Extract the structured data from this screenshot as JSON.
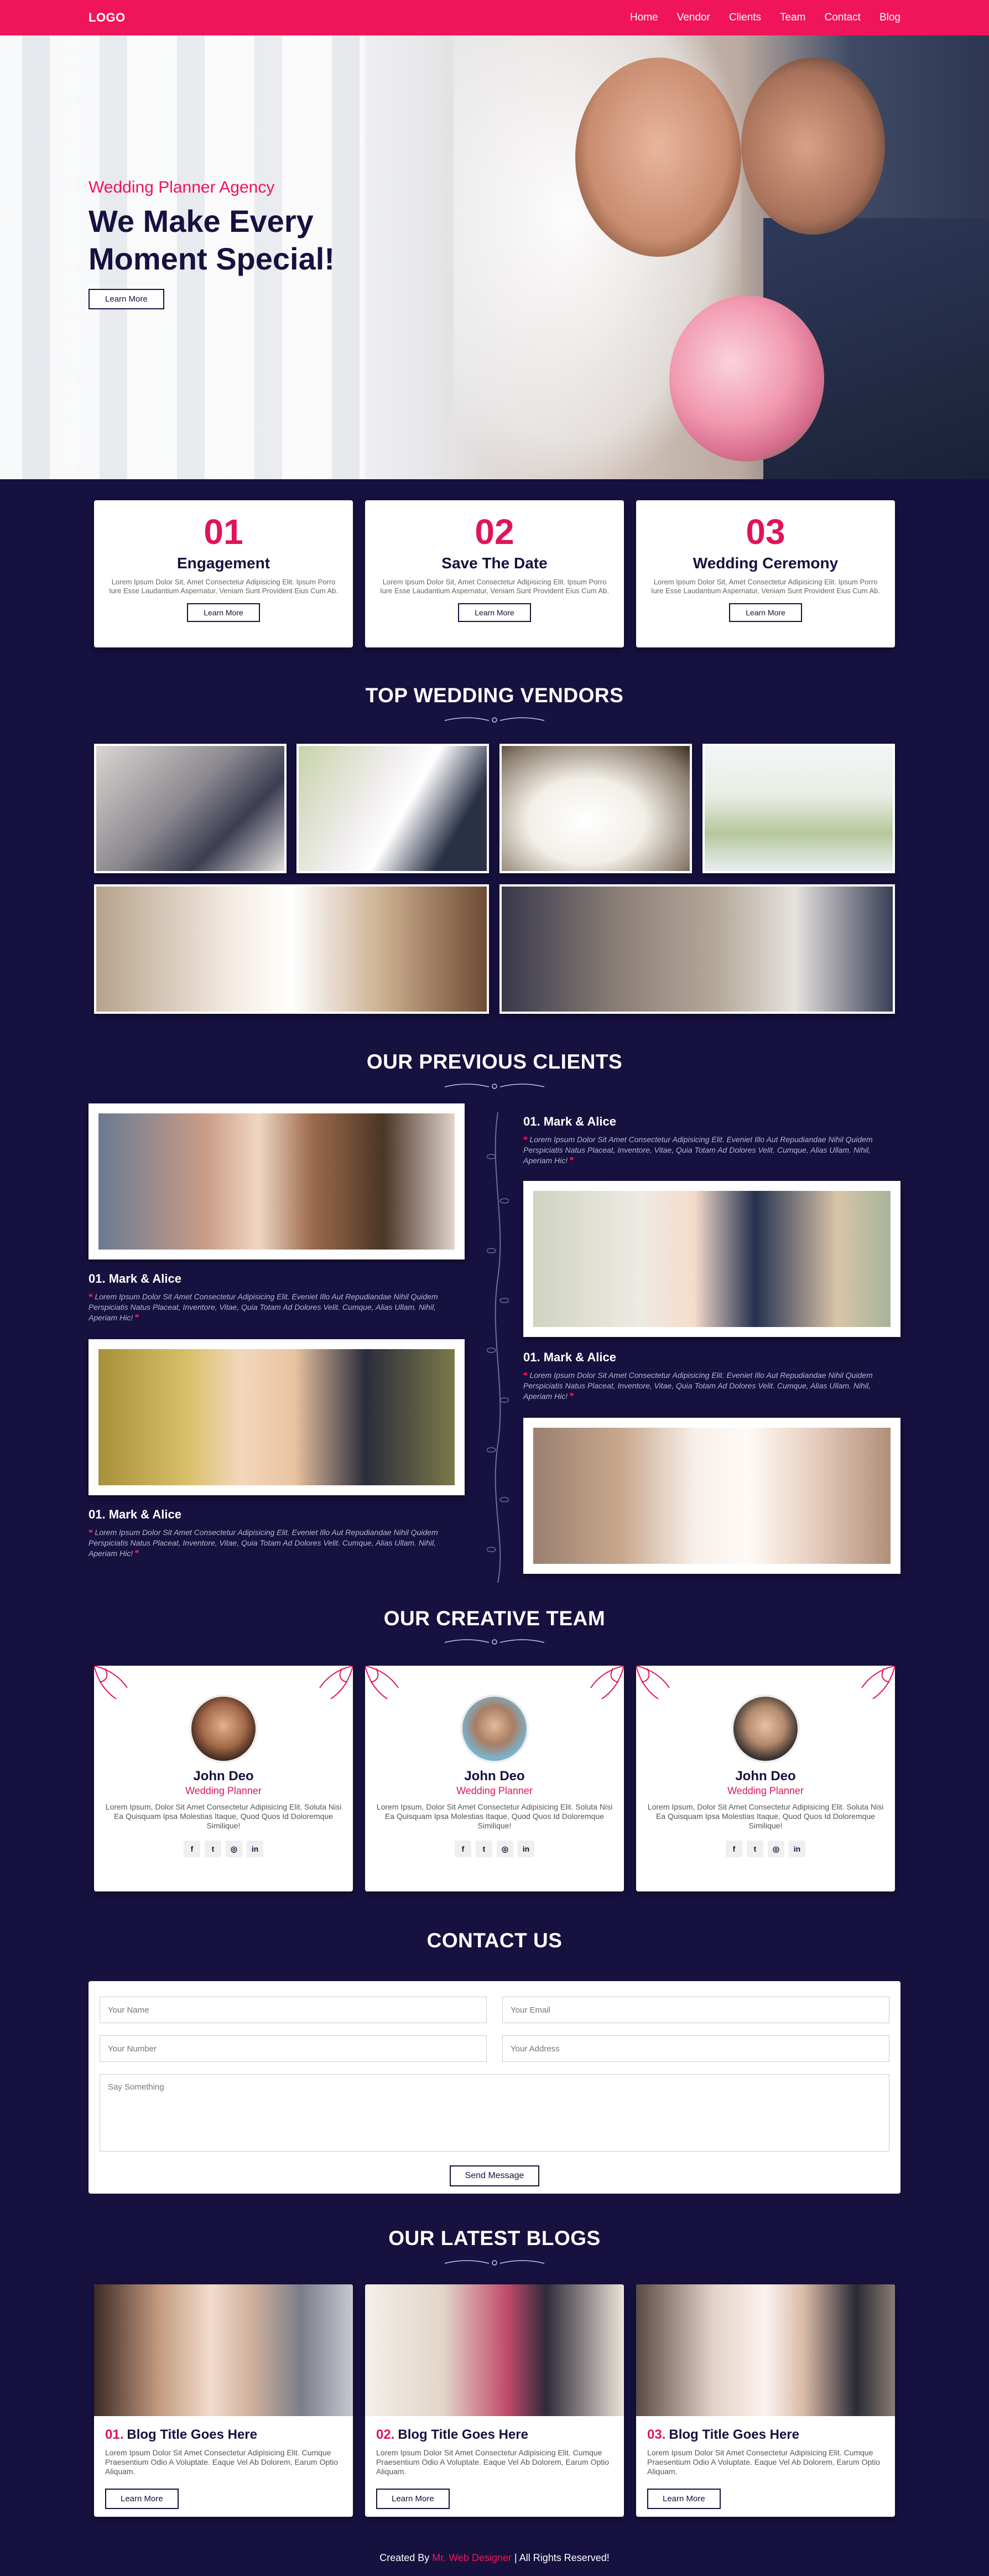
{
  "header": {
    "logo": "LOGO",
    "nav": [
      "Home",
      "Vendor",
      "Clients",
      "Team",
      "Contact",
      "Blog"
    ]
  },
  "hero": {
    "subtitle": "Wedding Planner Agency",
    "title": "We Make Every Moment Special!",
    "button": "Learn More"
  },
  "steps": [
    {
      "num": "01",
      "title": "Engagement",
      "text": "Lorem Ipsum Dolor Sit, Amet Consectetur Adipisicing Elit. Ipsum Porro Iure Esse Laudantium Aspernatur, Veniam Sunt Provident Eius Cum Ab.",
      "button": "Learn More"
    },
    {
      "num": "02",
      "title": "Save The Date",
      "text": "Lorem Ipsum Dolor Sit, Amet Consectetur Adipisicing Elit. Ipsum Porro Iure Esse Laudantium Aspernatur, Veniam Sunt Provident Eius Cum Ab.",
      "button": "Learn More"
    },
    {
      "num": "03",
      "title": "Wedding Ceremony",
      "text": "Lorem Ipsum Dolor Sit, Amet Consectetur Adipisicing Elit. Ipsum Porro Iure Esse Laudantium Aspernatur, Veniam Sunt Provident Eius Cum Ab.",
      "button": "Learn More"
    }
  ],
  "vendors": {
    "title": "TOP WEDDING VENDORS"
  },
  "clients": {
    "title": "OUR PREVIOUS CLIENTS",
    "items": [
      {
        "name": "01. Mark & Alice",
        "text": "Lorem Ipsum Dolor Sit Amet Consectetur Adipisicing Elit. Eveniet Illo Aut Repudiandae Nihil Quidem Perspiciatis Natus Placeat, Inventore, Vitae, Quia Totam Ad Dolores Velit. Cumque, Alias Ullam. Nihil, Aperiam Hic!"
      },
      {
        "name": "01. Mark & Alice",
        "text": "Lorem Ipsum Dolor Sit Amet Consectetur Adipisicing Elit. Eveniet Illo Aut Repudiandae Nihil Quidem Perspiciatis Natus Placeat, Inventore, Vitae, Quia Totam Ad Dolores Velit. Cumque, Alias Ullam. Nihil, Aperiam Hic!"
      },
      {
        "name": "01. Mark & Alice",
        "text": "Lorem Ipsum Dolor Sit Amet Consectetur Adipisicing Elit. Eveniet Illo Aut Repudiandae Nihil Quidem Perspiciatis Natus Placeat, Inventore, Vitae, Quia Totam Ad Dolores Velit. Cumque, Alias Ullam. Nihil, Aperiam Hic!"
      },
      {
        "name": "01. Mark & Alice",
        "text": "Lorem Ipsum Dolor Sit Amet Consectetur Adipisicing Elit. Eveniet Illo Aut Repudiandae Nihil Quidem Perspiciatis Natus Placeat, Inventore, Vitae, Quia Totam Ad Dolores Velit. Cumque, Alias Ullam. Nihil, Aperiam Hic!"
      }
    ]
  },
  "team": {
    "title": "OUR CREATIVE TEAM",
    "members": [
      {
        "name": "John Deo",
        "role": "Wedding Planner",
        "text": "Lorem Ipsum, Dolor Sit Amet Consectetur Adipisicing Elit. Soluta Nisi Ea Quisquam Ipsa Molestias Itaque, Quod Quos Id Doloremque Similique!"
      },
      {
        "name": "John Deo",
        "role": "Wedding Planner",
        "text": "Lorem Ipsum, Dolor Sit Amet Consectetur Adipisicing Elit. Soluta Nisi Ea Quisquam Ipsa Molestias Itaque, Quod Quos Id Doloremque Similique!"
      },
      {
        "name": "John Deo",
        "role": "Wedding Planner",
        "text": "Lorem Ipsum, Dolor Sit Amet Consectetur Adipisicing Elit. Soluta Nisi Ea Quisquam Ipsa Molestias Itaque, Quod Quos Id Doloremque Similique!"
      }
    ],
    "social_icons": [
      "facebook-icon",
      "twitter-icon",
      "instagram-icon",
      "linkedin-icon"
    ]
  },
  "contact": {
    "title": "CONTACT US",
    "name_ph": "Your Name",
    "email_ph": "Your Email",
    "number_ph": "Your Number",
    "address_ph": "Your Address",
    "message_ph": "Say Something",
    "button": "Send Message"
  },
  "blogs": {
    "title": "OUR LATEST BLOGS",
    "items": [
      {
        "num": "01.",
        "title": "Blog Title Goes Here",
        "text": "Lorem Ipsum Dolor Sit Amet Consectetur Adipisicing Elit. Cumque Praesentium Odio A Voluptate. Eaque Vel Ab Dolorem, Earum Optio Aliquam.",
        "button": "Learn More"
      },
      {
        "num": "02.",
        "title": "Blog Title Goes Here",
        "text": "Lorem Ipsum Dolor Sit Amet Consectetur Adipisicing Elit. Cumque Praesentium Odio A Voluptate. Eaque Vel Ab Dolorem, Earum Optio Aliquam.",
        "button": "Learn More"
      },
      {
        "num": "03.",
        "title": "Blog Title Goes Here",
        "text": "Lorem Ipsum Dolor Sit Amet Consectetur Adipisicing Elit. Cumque Praesentium Odio A Voluptate. Eaque Vel Ab Dolorem, Earum Optio Aliquam.",
        "button": "Learn More"
      }
    ]
  },
  "footer": {
    "prefix": "Created By",
    "brand": "Mr. Web Designer",
    "suffix": "| All Rights Reserved!"
  },
  "colors": {
    "accent": "#f0145a",
    "navy": "#16113f"
  }
}
